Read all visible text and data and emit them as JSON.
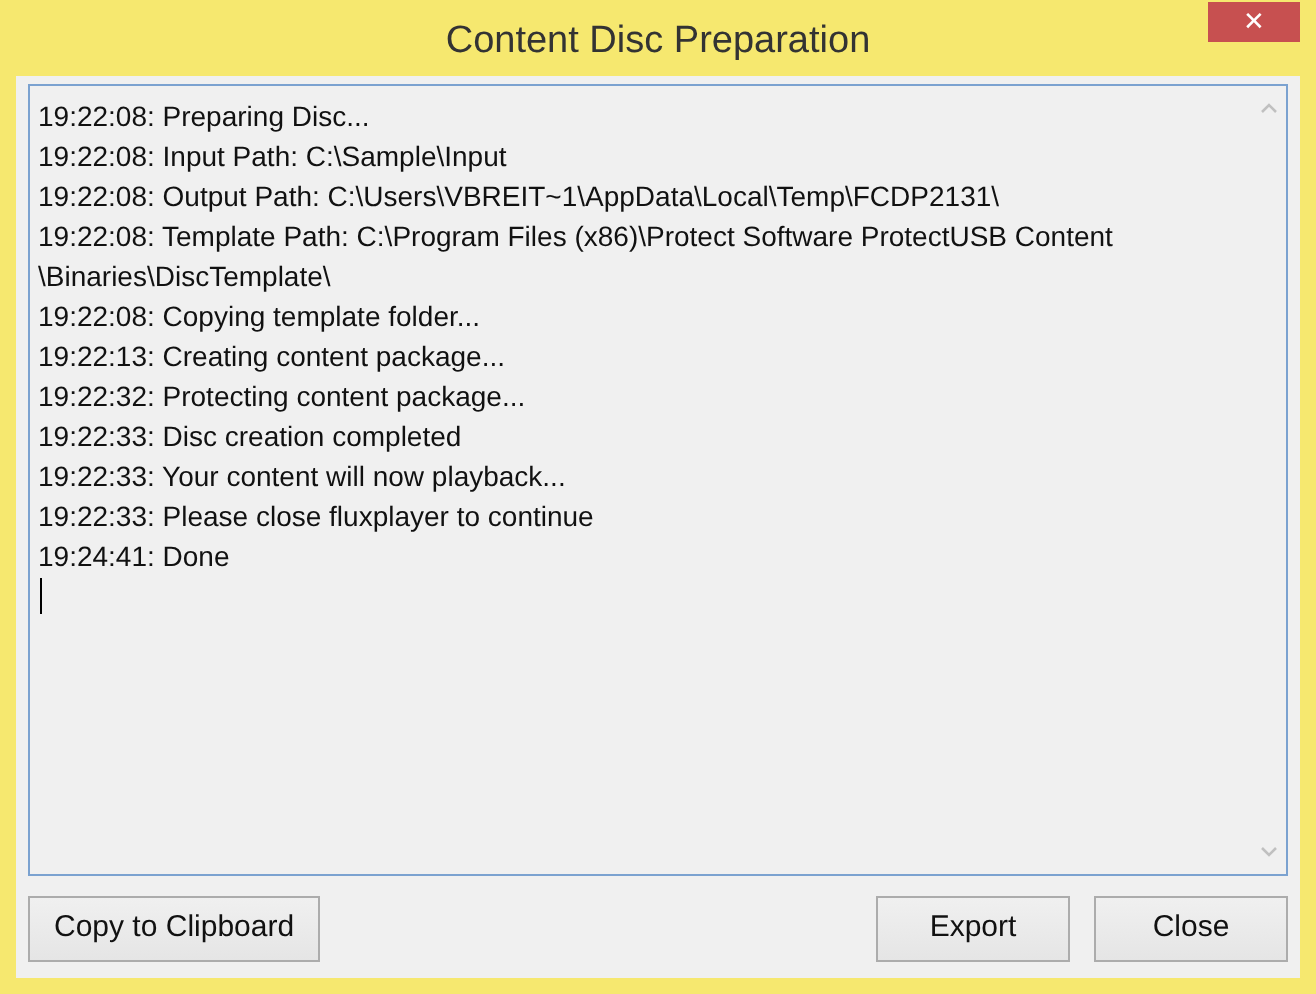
{
  "window": {
    "title": "Content Disc Preparation",
    "close_glyph": "✕"
  },
  "log": {
    "lines": [
      "19:22:08: Preparing Disc...",
      "19:22:08: Input Path: C:\\Sample\\Input",
      "19:22:08: Output Path: C:\\Users\\VBREIT~1\\AppData\\Local\\Temp\\FCDP2131\\",
      "19:22:08: Template Path: C:\\Program Files (x86)\\Protect Software ProtectUSB Content",
      "\\Binaries\\DiscTemplate\\",
      "19:22:08: Copying template folder...",
      "19:22:13: Creating content package...",
      "19:22:32: Protecting content package...",
      "19:22:33: Disc creation completed",
      "19:22:33: Your content will now playback...",
      "19:22:33: Please close fluxplayer to continue",
      "19:24:41: Done"
    ]
  },
  "buttons": {
    "left": [
      "Copy to Clipboard"
    ],
    "right": [
      "Export",
      "Close"
    ]
  }
}
